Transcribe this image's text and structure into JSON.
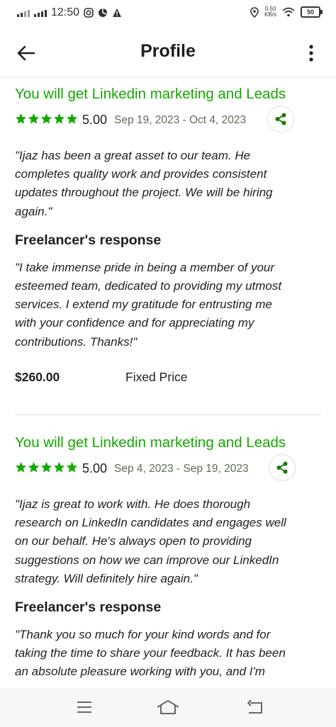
{
  "status_bar": {
    "time": "12:50",
    "net_speed_value": "0.50",
    "net_speed_unit": "KB/s",
    "battery": "50"
  },
  "header": {
    "title": "Profile"
  },
  "reviews": [
    {
      "title": "You will get Linkedin marketing and Leads",
      "rating": "5.00",
      "stars": 5,
      "dates": "Sep 19, 2023 - Oct 4, 2023",
      "quote_lines": [
        "\"Ijaz has been a great asset to our team. He",
        "completes quality work and provides consistent",
        "updates throughout the project. We will be hiring",
        "again.\""
      ],
      "response_heading": "Freelancer's response",
      "response_lines": [
        "\"I take immense pride in being a member of your",
        "esteemed team, dedicated to providing my utmost",
        "services. I extend my gratitude for entrusting me",
        "with your confidence and for appreciating my",
        "contributions. Thanks!\""
      ],
      "price": "$260.00",
      "price_type": "Fixed Price"
    },
    {
      "title": "You will get Linkedin marketing and Leads",
      "rating": "5.00",
      "stars": 5,
      "dates": "Sep 4, 2023 - Sep 19, 2023",
      "quote_lines": [
        "\"Ijaz is great to work with. He does thorough",
        "research on LinkedIn candidates and engages well",
        "on our behalf. He's always open to providing",
        "suggestions on how we can improve our LinkedIn",
        "strategy. Will definitely hire again.\""
      ],
      "response_heading": "Freelancer's response",
      "response_lines": [
        "\"Thank you so much for your kind words and for",
        "taking the time to share your feedback. It has been",
        "an absolute pleasure working with you, and I'm"
      ]
    }
  ],
  "colors": {
    "accent_green": "#14a800",
    "text": "#1e1e1e",
    "date_text": "#5e6d55"
  }
}
